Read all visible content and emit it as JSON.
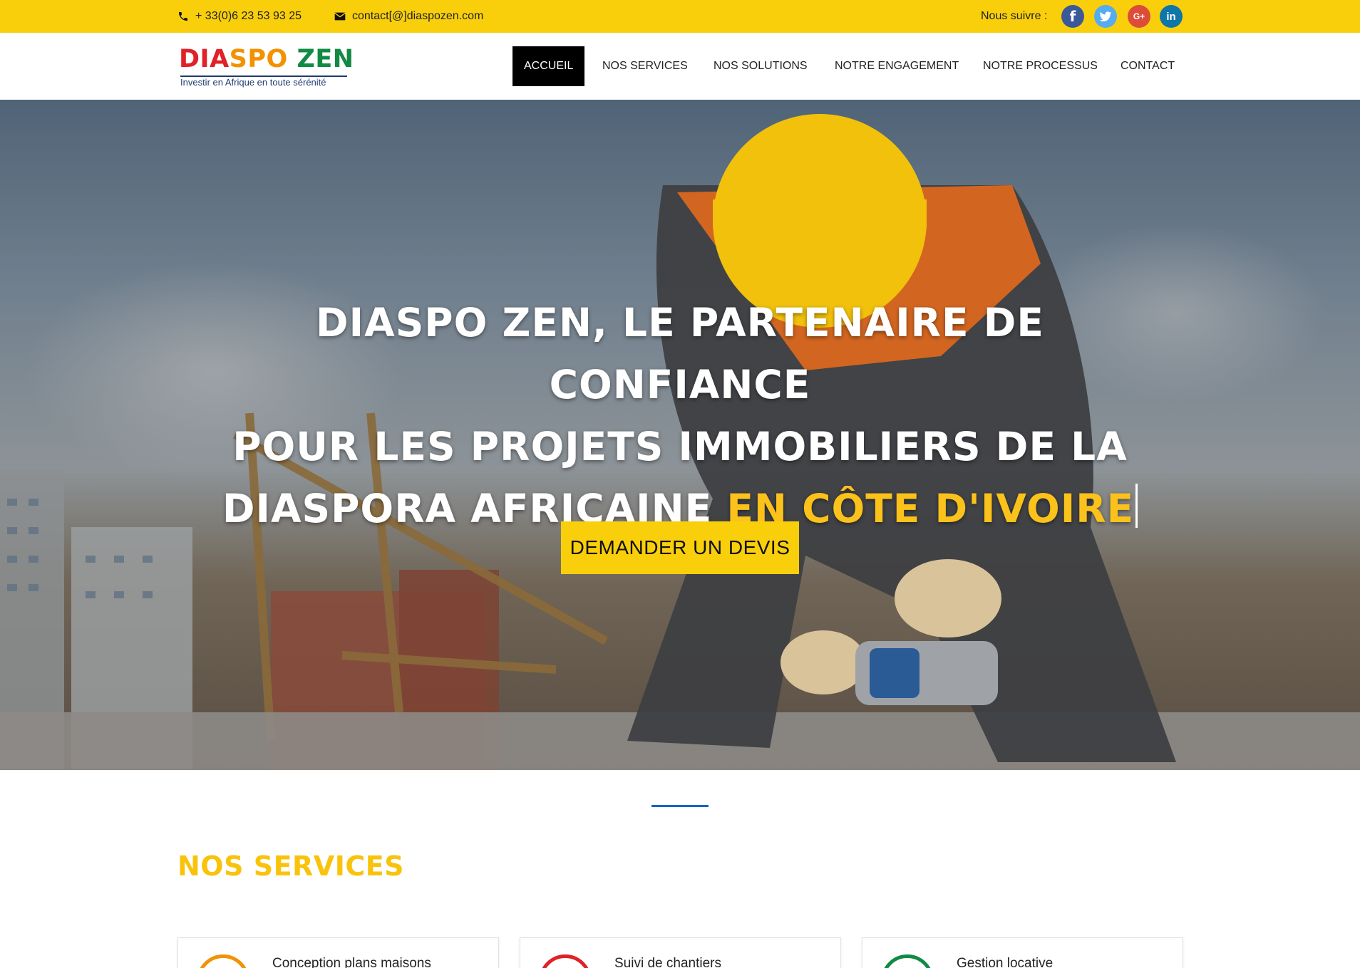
{
  "topbar": {
    "phone": "+ 33(0)6 23 53 93 25",
    "email": "contact[@]diaspozen.com",
    "follow_label": "Nous suivre :",
    "social": [
      {
        "name": "facebook",
        "glyph": "f"
      },
      {
        "name": "twitter",
        "glyph": ""
      },
      {
        "name": "google-plus",
        "glyph": "G+"
      },
      {
        "name": "linkedin",
        "glyph": "in"
      }
    ]
  },
  "logo": {
    "part1": "DI",
    "part2": "A",
    "part3": "SPO",
    "part4": "ZEN",
    "tagline": "Investir en Afrique en toute sérénité"
  },
  "nav": {
    "items": [
      "ACCUEIL",
      "NOS SERVICES",
      "NOS SOLUTIONS",
      "NOTRE ENGAGEMENT",
      "NOTRE PROCESSUS",
      "CONTACT"
    ],
    "active": "ACCUEIL"
  },
  "hero": {
    "title_line1": "DIASPO ZEN, LE PARTENAIRE DE CONFIANCE",
    "title_line2": "POUR LES PROJETS IMMOBILIERS DE LA",
    "title_line3": "DIASPORA AFRICAINE",
    "title_highlight": "EN CÔTE D'IVOIRE",
    "cta": "DEMANDER UN DEVIS"
  },
  "services": {
    "heading": "NOS SERVICES",
    "cards": [
      {
        "title": "Conception plans maisons",
        "color": "#f39200"
      },
      {
        "title": "Suivi de chantiers",
        "color": "#e02127"
      },
      {
        "title": "Gestion locative",
        "color": "#128a43"
      }
    ]
  },
  "colors": {
    "accent_yellow": "#f9cf0c",
    "highlight_yellow": "#fbc21b",
    "divider_blue": "#1565c0"
  }
}
